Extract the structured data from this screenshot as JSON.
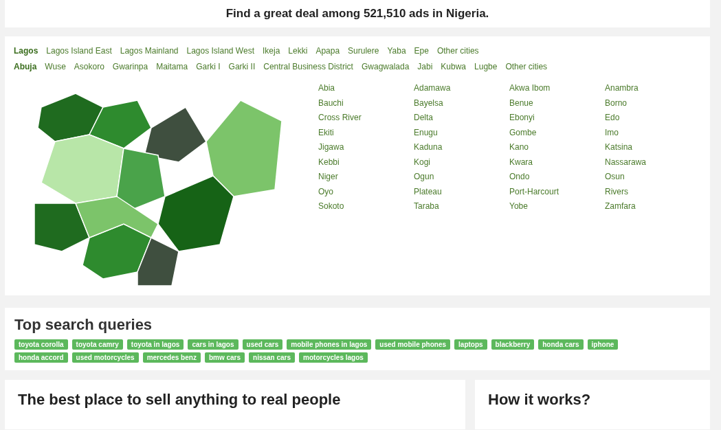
{
  "headline": "Find a great deal among 521,510 ads in Nigeria.",
  "city_rows": [
    {
      "city": "Lagos",
      "areas": [
        "Lagos Island East",
        "Lagos Mainland",
        "Lagos Island West",
        "Ikeja",
        "Lekki",
        "Apapa",
        "Surulere",
        "Yaba",
        "Epe",
        "Other cities"
      ]
    },
    {
      "city": "Abuja",
      "areas": [
        "Wuse",
        "Asokoro",
        "Gwarinpa",
        "Maitama",
        "Garki I",
        "Garki II",
        "Central Business District",
        "Gwagwalada",
        "Jabi",
        "Kubwa",
        "Lugbe",
        "Other cities"
      ]
    }
  ],
  "states": [
    "Abia",
    "Adamawa",
    "Akwa Ibom",
    "Anambra",
    "Bauchi",
    "Bayelsa",
    "Benue",
    "Borno",
    "Cross River",
    "Delta",
    "Ebonyi",
    "Edo",
    "Ekiti",
    "Enugu",
    "Gombe",
    "Imo",
    "Jigawa",
    "Kaduna",
    "Kano",
    "Katsina",
    "Kebbi",
    "Kogi",
    "Kwara",
    "Nassarawa",
    "Niger",
    "Ogun",
    "Ondo",
    "Osun",
    "Oyo",
    "Plateau",
    "Port-Harcourt",
    "Rivers",
    "Sokoto",
    "Taraba",
    "Yobe",
    "Zamfara"
  ],
  "top_queries": {
    "title": "Top search queries",
    "tags": [
      "toyota corolla",
      "toyota camry",
      "toyota in lagos",
      "cars in lagos",
      "used cars",
      "mobile phones in lagos",
      "used mobile phones",
      "laptops",
      "blackberry",
      "honda cars",
      "iphone",
      "honda accord",
      "used motorcycles",
      "mercedes benz",
      "bmw cars",
      "nissan cars",
      "motorcycles lagos"
    ]
  },
  "sections": [
    "The best place to sell anything to real people",
    "How it works?"
  ]
}
